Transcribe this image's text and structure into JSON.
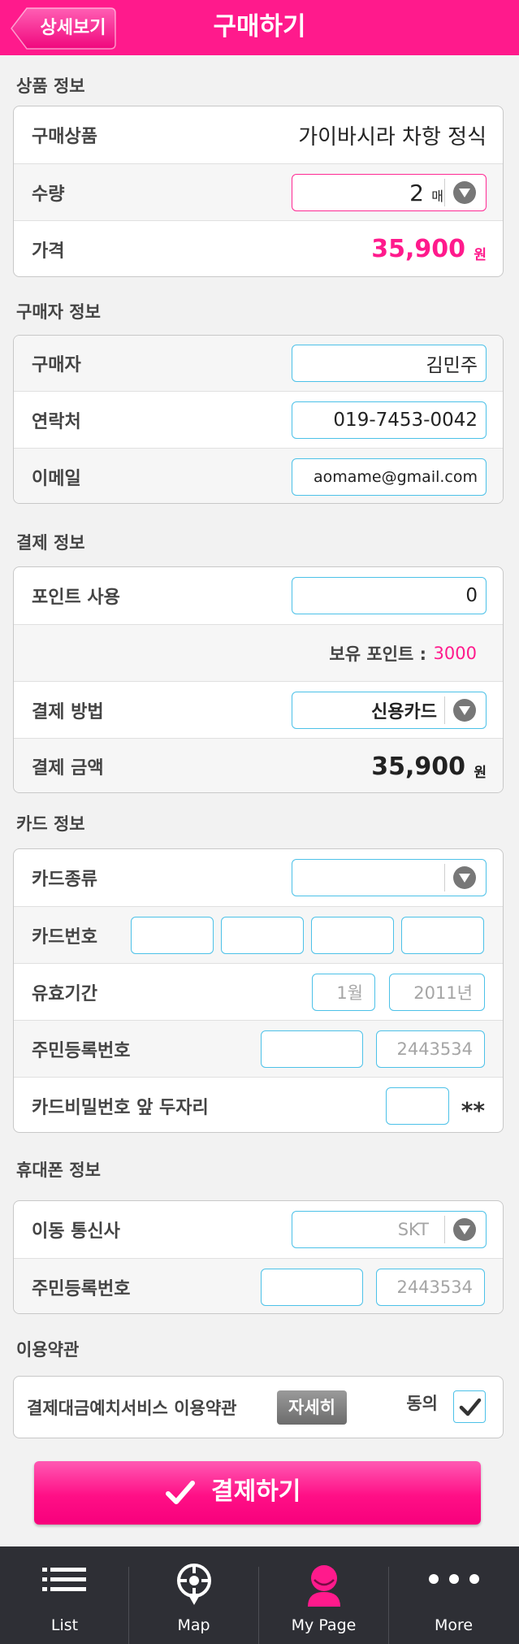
{
  "header": {
    "back_label": "상세보기",
    "title": "구매하기"
  },
  "product_section": {
    "title": "상품 정보",
    "product_label": "구매상품",
    "product_name": "가이바시라 차항 정식",
    "quantity_label": "수량",
    "quantity_value": "2",
    "quantity_unit": "매",
    "price_label": "가격",
    "price_value": "35,900",
    "price_unit": "원"
  },
  "buyer_section": {
    "title": "구매자 정보",
    "buyer_label": "구매자",
    "buyer_value": "김민주",
    "contact_label": "연락처",
    "contact_value": "019-7453-0042",
    "email_label": "이메일",
    "email_value": "aomame@gmail.com"
  },
  "payment_section": {
    "title": "결제 정보",
    "points_label": "포인트 사용",
    "points_value": "0",
    "owned_points_label": "보유 포인트 :",
    "owned_points_value": "3000",
    "method_label": "결제 방법",
    "method_value": "신용카드",
    "amount_label": "결제 금액",
    "amount_value": "35,900",
    "amount_unit": "원"
  },
  "card_section": {
    "title": "카드 정보",
    "type_label": "카드종류",
    "type_value": "",
    "number_label": "카드번호",
    "number_fields": [
      "",
      "",
      "",
      ""
    ],
    "expiry_label": "유효기간",
    "expiry_month_placeholder": "1월",
    "expiry_year_placeholder": "2011년",
    "rrn_label": "주민등록번호",
    "rrn_front": "",
    "rrn_back_placeholder": "2443534",
    "pin_label": "카드비밀번호 앞 두자리",
    "pin_mask": "**"
  },
  "phone_section": {
    "title": "휴대폰 정보",
    "carrier_label": "이동 통신사",
    "carrier_placeholder": "SKT",
    "rrn_label": "주민등록번호",
    "rrn_front": "",
    "rrn_back_placeholder": "2443534"
  },
  "terms_section": {
    "title": "이용약관",
    "terms_label": "결제대금예치서비스 이용약관",
    "detail_button": "자세히",
    "agree_label": "동의",
    "agreed": true
  },
  "pay_button_label": "결제하기",
  "tabbar": {
    "tabs": [
      {
        "label": "List",
        "icon": "list-icon"
      },
      {
        "label": "Map",
        "icon": "map-pin-icon"
      },
      {
        "label": "My Page",
        "icon": "person-icon"
      },
      {
        "label": "More",
        "icon": "more-dots-icon"
      }
    ]
  },
  "colors": {
    "brand": "#ff1a8c",
    "field_border": "#4cc1e8",
    "tabbar_bg": "#2e2f35"
  }
}
